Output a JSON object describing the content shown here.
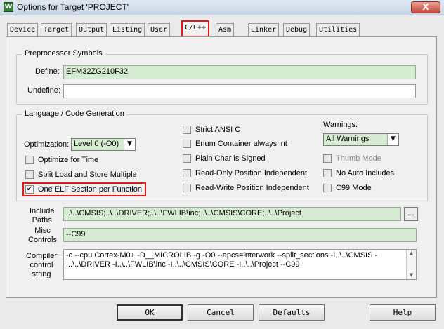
{
  "window": {
    "title": "Options for Target 'PROJECT'",
    "close_label": "X",
    "app_icon_label": "W"
  },
  "tabs": [
    {
      "label": "Device"
    },
    {
      "label": "Target"
    },
    {
      "label": "Output"
    },
    {
      "label": "Listing"
    },
    {
      "label": "User"
    },
    {
      "label": "C/C++"
    },
    {
      "label": "Asm"
    },
    {
      "label": "Linker"
    },
    {
      "label": "Debug"
    },
    {
      "label": "Utilities"
    }
  ],
  "preprocessor": {
    "group_title": "Preprocessor Symbols",
    "define_label": "Define:",
    "define_value": "EFM32ZG210F32",
    "undefine_label": "Undefine:",
    "undefine_value": ""
  },
  "language": {
    "group_title": "Language / Code Generation",
    "optimization_label": "Optimization:",
    "optimization_value": "Level 0 (-O0)",
    "left_options": [
      {
        "label": "Optimize for Time",
        "checked": false
      },
      {
        "label": "Split Load and Store Multiple",
        "checked": false
      },
      {
        "label": "One ELF Section per Function",
        "checked": true
      }
    ],
    "mid_options": [
      {
        "label": "Strict ANSI C",
        "checked": false
      },
      {
        "label": "Enum Container always int",
        "checked": false
      },
      {
        "label": "Plain Char is Signed",
        "checked": false
      },
      {
        "label": "Read-Only Position Independent",
        "checked": false
      },
      {
        "label": "Read-Write Position Independent",
        "checked": false
      }
    ],
    "warnings_label": "Warnings:",
    "warnings_value": "All Warnings",
    "right_options": [
      {
        "label": "Thumb Mode",
        "checked": false,
        "disabled": true
      },
      {
        "label": "No Auto Includes",
        "checked": false
      },
      {
        "label": "C99 Mode",
        "checked": false
      }
    ]
  },
  "include_paths": {
    "label_line1": "Include",
    "label_line2": "Paths",
    "value": "..\\..\\CMSIS;..\\..\\DRIVER;..\\..\\FWLIB\\inc;..\\..\\CMSIS\\CORE;..\\..\\Project",
    "browse_label": "..."
  },
  "misc_controls": {
    "label_line1": "Misc",
    "label_line2": "Controls",
    "value": "--C99"
  },
  "compiler_string": {
    "label_line1": "Compiler",
    "label_line2": "control",
    "label_line3": "string",
    "value": "-c --cpu Cortex-M0+ -D__MICROLIB -g -O0 --apcs=interwork --split_sections -I..\\..\\CMSIS -I..\\..\\DRIVER -I..\\..\\FWLIB\\inc -I..\\..\\CMSIS\\CORE -I..\\..\\Project --C99"
  },
  "buttons": {
    "ok": "OK",
    "cancel": "Cancel",
    "defaults": "Defaults",
    "help": "Help"
  },
  "check_mark": "✔",
  "colors": {
    "highlight": "#e01a1a",
    "field_green": "#d6ecd2"
  }
}
